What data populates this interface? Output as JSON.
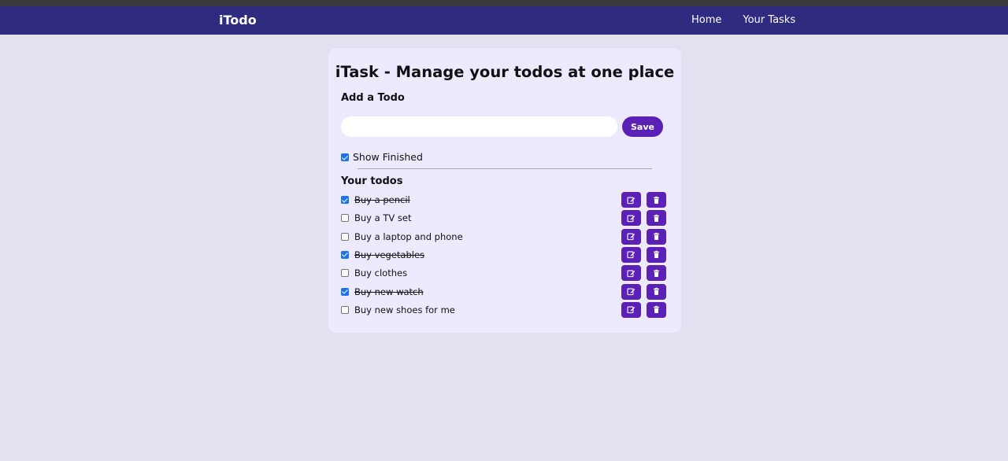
{
  "navbar": {
    "brand": "iTodo",
    "links": [
      {
        "label": "Home"
      },
      {
        "label": "Your Tasks"
      }
    ]
  },
  "main": {
    "title": "iTask - Manage your todos at one place",
    "add_label": "Add a Todo",
    "input_value": "",
    "save_label": "Save",
    "show_finished": {
      "label": "Show Finished",
      "checked": true
    },
    "todos_heading": "Your todos",
    "todos": [
      {
        "text": "Buy a pencil",
        "done": true
      },
      {
        "text": "Buy a TV set",
        "done": false
      },
      {
        "text": "Buy a laptop and phone",
        "done": false
      },
      {
        "text": "Buy vegetables",
        "done": true
      },
      {
        "text": "Buy clothes",
        "done": false
      },
      {
        "text": "Buy new watch",
        "done": true
      },
      {
        "text": "Buy new shoes for me",
        "done": false
      }
    ]
  },
  "colors": {
    "navbar": "#2f2c80",
    "background": "#e3e1ef",
    "card": "#ede9fe",
    "accent": "#5b21b6",
    "checkbox": "#1a73e8"
  },
  "icons": {
    "edit": "edit-icon",
    "delete": "trash-icon"
  }
}
